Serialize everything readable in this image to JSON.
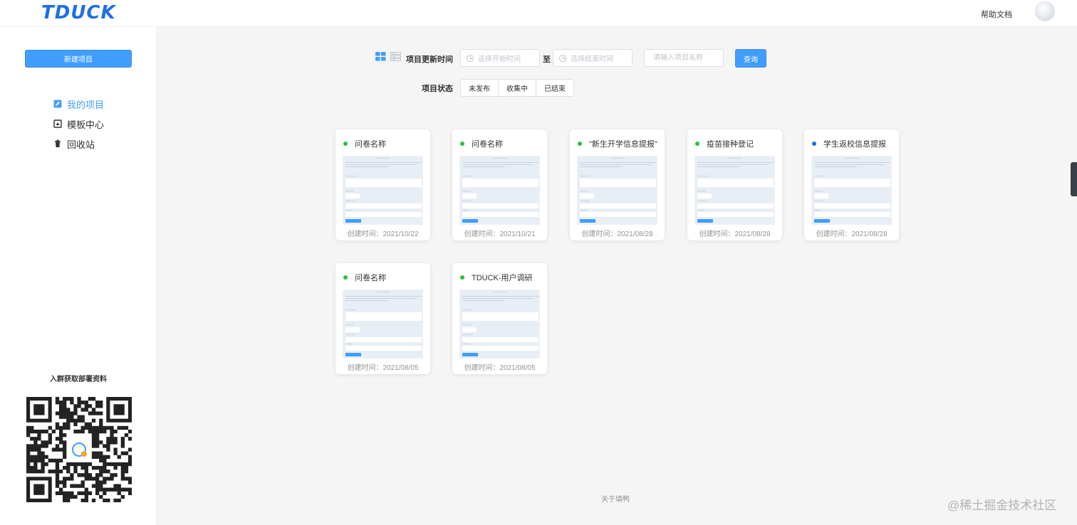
{
  "header": {
    "logo": "TDUCK",
    "help_label": "帮助文档"
  },
  "sidebar": {
    "new_project_label": "新建项目",
    "menu": [
      {
        "label": "我的项目",
        "icon": "edit-square-icon",
        "active": true
      },
      {
        "label": "模板中心",
        "icon": "template-icon",
        "active": false
      },
      {
        "label": "回收站",
        "icon": "trash-icon",
        "active": false
      }
    ],
    "qr_title": "入群获取部署资料"
  },
  "filter": {
    "update_time_label": "项目更新时间",
    "start_placeholder": "选择开始时间",
    "separator": "至",
    "end_placeholder": "选择结束时间",
    "name_placeholder": "请输入项目名称",
    "query_label": "查询",
    "status_label": "项目状态",
    "status_options": [
      "未发布",
      "收集中",
      "已结束"
    ]
  },
  "colors": {
    "accent": "#409eff",
    "status_green": "#2dbd42",
    "status_blue": "#1f6fe5"
  },
  "cards": [
    {
      "title": "问卷名称",
      "date": "创建时间：2021/10/22",
      "status_color": "#2dbd42"
    },
    {
      "title": "问卷名称",
      "date": "创建时间：2021/10/21",
      "status_color": "#2dbd42"
    },
    {
      "title": "\"新生开学信息提报\"",
      "date": "创建时间：2021/08/28",
      "status_color": "#2dbd42"
    },
    {
      "title": "疫苗接种登记",
      "date": "创建时间：2021/08/28",
      "status_color": "#2dbd42"
    },
    {
      "title": "学生返校信息提报",
      "date": "创建时间：2021/08/28",
      "status_color": "#1f6fe5"
    },
    {
      "title": "问卷名称",
      "date": "创建时间：2021/08/05",
      "status_color": "#2dbd42"
    },
    {
      "title": "TDUCK-用户调研",
      "date": "创建时间：2021/08/05",
      "status_color": "#2dbd42"
    }
  ],
  "footer": {
    "about_label": "关于填鸭",
    "watermark": "@稀土掘金技术社区"
  }
}
